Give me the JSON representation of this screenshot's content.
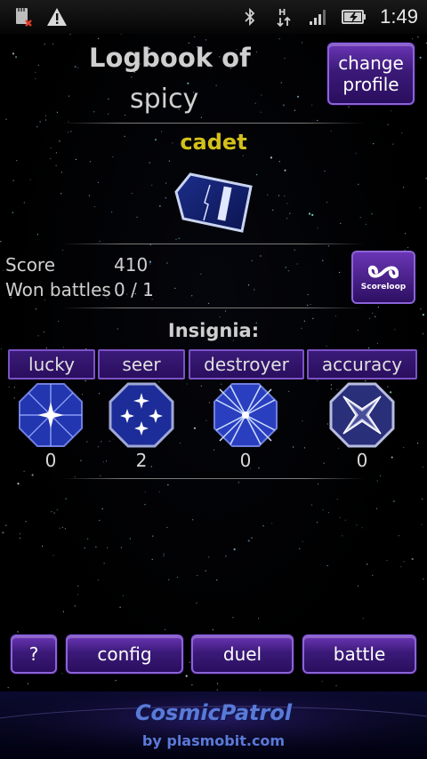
{
  "status_bar": {
    "time": "1:49",
    "icons": [
      "sd-card-error-icon",
      "warning-icon",
      "bluetooth-icon",
      "hspa-data-icon",
      "signal-icon",
      "battery-charging-icon"
    ]
  },
  "header": {
    "title_line1": "Logbook of",
    "title_line2": "spicy",
    "change_profile_line1": "change",
    "change_profile_line2": "profile"
  },
  "rank": {
    "label": "cadet"
  },
  "stats": {
    "score_label": "Score",
    "score_value": "410",
    "won_label": "Won battles",
    "won_value": "0 / 1",
    "scoreloop_label": "Scoreloop"
  },
  "insignia": {
    "title": "Insignia:",
    "items": [
      {
        "label": "lucky",
        "count": "0"
      },
      {
        "label": "seer",
        "count": "2"
      },
      {
        "label": "destroyer",
        "count": "0"
      },
      {
        "label": "accuracy",
        "count": "0"
      }
    ]
  },
  "bottom_nav": {
    "help": "?",
    "config": "config",
    "duel": "duel",
    "battle": "battle"
  },
  "footer": {
    "brand": "CosmicPatrol",
    "by": "by plasmobit.com"
  },
  "colors": {
    "button_purple": "#3b1a78",
    "button_border": "#8c63d8",
    "rank_yellow": "#d4c11a",
    "insignia_blue": "#2a3fb8"
  }
}
